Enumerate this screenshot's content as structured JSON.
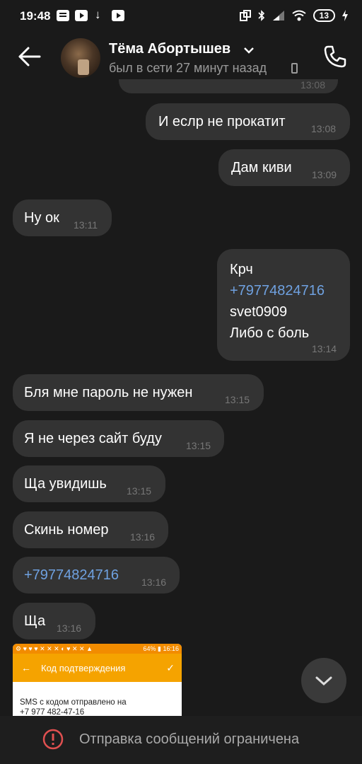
{
  "status_bar": {
    "time": "19:48",
    "battery": "13"
  },
  "header": {
    "contact_name": "Тёма Абортышев",
    "last_seen": "был в сети 27 минут назад"
  },
  "messages": [
    {
      "side": "out",
      "text": "И еслр не прокатит",
      "time": "13:08"
    },
    {
      "side": "out",
      "text": "Дам киви",
      "time": "13:09"
    },
    {
      "side": "in",
      "text": "Ну ок",
      "time": "13:11"
    },
    {
      "side": "out",
      "lines": [
        "Крч",
        "+79774824716",
        "svet0909",
        "Либо с боль"
      ],
      "time": "13:14"
    },
    {
      "side": "in",
      "text": "Бля мне пароль не нужен",
      "time": "13:15"
    },
    {
      "side": "in",
      "text": "Я не через сайт буду",
      "time": "13:15"
    },
    {
      "side": "in",
      "text": "Ща увидишь",
      "time": "13:15"
    },
    {
      "side": "in",
      "text": "Скинь номер",
      "time": "13:16"
    },
    {
      "side": "in",
      "text": "+79774824716",
      "time": "13:16"
    },
    {
      "side": "in",
      "text": "Ща",
      "time": "13:16"
    }
  ],
  "cut_message": {
    "time": "13:08"
  },
  "image_preview": {
    "status_battery": "64%",
    "status_time": "16:16",
    "title": "Код подтверждения",
    "line1": "SMS с кодом отправлено на",
    "line2": "+7 977 482-47-16"
  },
  "footer": {
    "text": "Отправка сообщений ограничена"
  }
}
